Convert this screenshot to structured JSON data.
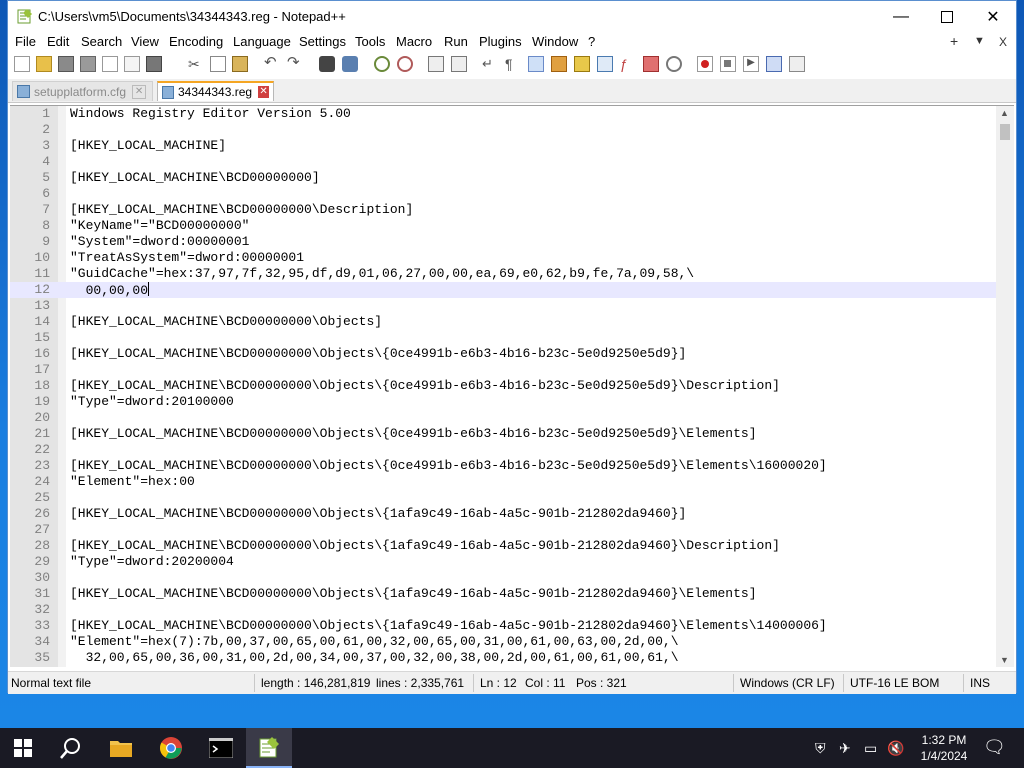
{
  "window": {
    "title": "C:\\Users\\vm5\\Documents\\34344343.reg - Notepad++"
  },
  "menu": [
    "File",
    "Edit",
    "Search",
    "View",
    "Encoding",
    "Language",
    "Settings",
    "Tools",
    "Macro",
    "Run",
    "Plugins",
    "Window",
    "?"
  ],
  "menu_right": {
    "plus": "+",
    "dropdown": "▼",
    "close": "X"
  },
  "tabs": [
    {
      "label": "setupplatform.cfg",
      "active": false
    },
    {
      "label": "34344343.reg",
      "active": true
    }
  ],
  "editor": {
    "current_line": 12,
    "lines": [
      {
        "n": "1",
        "t": "Windows Registry Editor Version 5.00"
      },
      {
        "n": "2",
        "t": ""
      },
      {
        "n": "3",
        "t": "[HKEY_LOCAL_MACHINE]"
      },
      {
        "n": "4",
        "t": ""
      },
      {
        "n": "5",
        "t": "[HKEY_LOCAL_MACHINE\\BCD00000000]"
      },
      {
        "n": "6",
        "t": ""
      },
      {
        "n": "7",
        "t": "[HKEY_LOCAL_MACHINE\\BCD00000000\\Description]"
      },
      {
        "n": "8",
        "t": "\"KeyName\"=\"BCD00000000\""
      },
      {
        "n": "9",
        "t": "\"System\"=dword:00000001"
      },
      {
        "n": "10",
        "t": "\"TreatAsSystem\"=dword:00000001"
      },
      {
        "n": "11",
        "t": "\"GuidCache\"=hex:37,97,7f,32,95,df,d9,01,06,27,00,00,ea,69,e0,62,b9,fe,7a,09,58,\\"
      },
      {
        "n": "12",
        "t": "  00,00,00"
      },
      {
        "n": "13",
        "t": ""
      },
      {
        "n": "14",
        "t": "[HKEY_LOCAL_MACHINE\\BCD00000000\\Objects]"
      },
      {
        "n": "15",
        "t": ""
      },
      {
        "n": "16",
        "t": "[HKEY_LOCAL_MACHINE\\BCD00000000\\Objects\\{0ce4991b-e6b3-4b16-b23c-5e0d9250e5d9}]"
      },
      {
        "n": "17",
        "t": ""
      },
      {
        "n": "18",
        "t": "[HKEY_LOCAL_MACHINE\\BCD00000000\\Objects\\{0ce4991b-e6b3-4b16-b23c-5e0d9250e5d9}\\Description]"
      },
      {
        "n": "19",
        "t": "\"Type\"=dword:20100000"
      },
      {
        "n": "20",
        "t": ""
      },
      {
        "n": "21",
        "t": "[HKEY_LOCAL_MACHINE\\BCD00000000\\Objects\\{0ce4991b-e6b3-4b16-b23c-5e0d9250e5d9}\\Elements]"
      },
      {
        "n": "22",
        "t": ""
      },
      {
        "n": "23",
        "t": "[HKEY_LOCAL_MACHINE\\BCD00000000\\Objects\\{0ce4991b-e6b3-4b16-b23c-5e0d9250e5d9}\\Elements\\16000020]"
      },
      {
        "n": "24",
        "t": "\"Element\"=hex:00"
      },
      {
        "n": "25",
        "t": ""
      },
      {
        "n": "26",
        "t": "[HKEY_LOCAL_MACHINE\\BCD00000000\\Objects\\{1afa9c49-16ab-4a5c-901b-212802da9460}]"
      },
      {
        "n": "27",
        "t": ""
      },
      {
        "n": "28",
        "t": "[HKEY_LOCAL_MACHINE\\BCD00000000\\Objects\\{1afa9c49-16ab-4a5c-901b-212802da9460}\\Description]"
      },
      {
        "n": "29",
        "t": "\"Type\"=dword:20200004"
      },
      {
        "n": "30",
        "t": ""
      },
      {
        "n": "31",
        "t": "[HKEY_LOCAL_MACHINE\\BCD00000000\\Objects\\{1afa9c49-16ab-4a5c-901b-212802da9460}\\Elements]"
      },
      {
        "n": "32",
        "t": ""
      },
      {
        "n": "33",
        "t": "[HKEY_LOCAL_MACHINE\\BCD00000000\\Objects\\{1afa9c49-16ab-4a5c-901b-212802da9460}\\Elements\\14000006]"
      },
      {
        "n": "34",
        "t": "\"Element\"=hex(7):7b,00,37,00,65,00,61,00,32,00,65,00,31,00,61,00,63,00,2d,00,\\"
      },
      {
        "n": "35",
        "t": "  32,00,65,00,36,00,31,00,2d,00,34,00,37,00,32,00,38,00,2d,00,61,00,61,00,61,\\"
      }
    ]
  },
  "status": {
    "file_type": "Normal text file",
    "length": "length : 146,281,819",
    "lines": "lines : 2,335,761",
    "ln": "Ln : 12",
    "col": "Col : 11",
    "pos": "Pos : 321",
    "eol": "Windows (CR LF)",
    "encoding": "UTF-16 LE BOM",
    "mode": "INS"
  },
  "taskbar": {
    "time": "1:32 PM",
    "date": "1/4/2024"
  },
  "colors": {
    "accent": "#f5a623",
    "current_line": "#e8e8ff",
    "gutter": "#e4e4e4",
    "taskbar": "#1a1a24"
  }
}
